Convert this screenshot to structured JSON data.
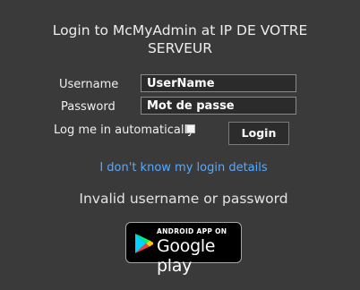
{
  "header": {
    "title_line1": "Login to McMyAdmin at IP DE VOTRE",
    "title_line2": "SERVEUR"
  },
  "form": {
    "username_label": "Username",
    "username_value": "UserName",
    "password_label": "Password",
    "password_value": "Mot de passe",
    "remember_label": "Log me in automatically",
    "remember_checked": false,
    "login_button": "Login"
  },
  "links": {
    "help": "I don't know my login details"
  },
  "status": {
    "error": "Invalid username or password"
  },
  "badge": {
    "small_text": "ANDROID APP ON",
    "big_text": "Google play",
    "icon": "google-play-icon"
  },
  "colors": {
    "background": "#3a3a3a",
    "link": "#5aa8ff"
  }
}
